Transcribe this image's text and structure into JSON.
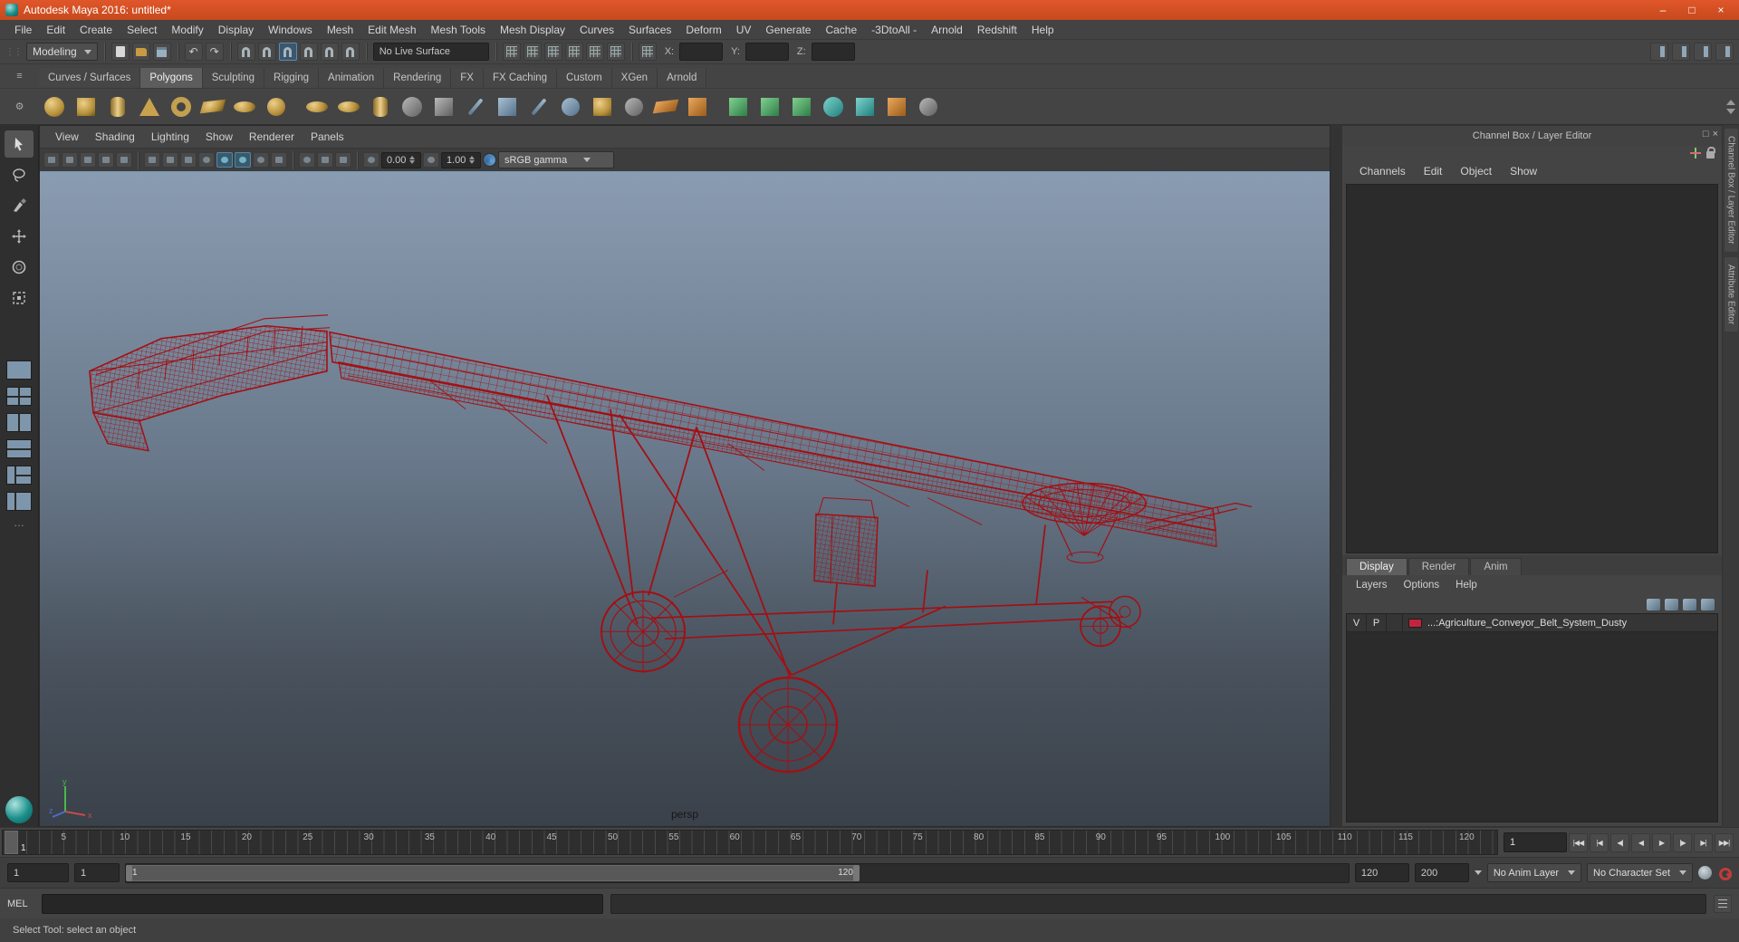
{
  "window": {
    "title": "Autodesk Maya 2016: untitled*",
    "minimize": "–",
    "maximize": "□",
    "close": "×"
  },
  "menubar": [
    "File",
    "Edit",
    "Create",
    "Select",
    "Modify",
    "Display",
    "Windows",
    "Mesh",
    "Edit Mesh",
    "Mesh Tools",
    "Mesh Display",
    "Curves",
    "Surfaces",
    "Deform",
    "UV",
    "Generate",
    "Cache",
    "-3DtoAll -",
    "Arnold",
    "Redshift",
    "Help"
  ],
  "status_line": {
    "mode": "Modeling",
    "live_surface": "No Live Surface",
    "x_label": "X:",
    "y_label": "Y:",
    "z_label": "Z:"
  },
  "icons": {
    "undo": "↶",
    "redo": "↷",
    "dock": "□",
    "close_small": "×",
    "hamburger": "≡",
    "gear": "⚙"
  },
  "shelf_tabs": [
    "Curves / Surfaces",
    "Polygons",
    "Sculpting",
    "Rigging",
    "Animation",
    "Rendering",
    "FX",
    "FX Caching",
    "Custom",
    "XGen",
    "Arnold"
  ],
  "viewport": {
    "menus": [
      "View",
      "Shading",
      "Lighting",
      "Show",
      "Renderer",
      "Panels"
    ],
    "exposure": "0.00",
    "gamma": "1.00",
    "colorspace": "sRGB gamma",
    "camera_label": "persp",
    "axis": {
      "x": "x",
      "y": "y",
      "z": "z"
    }
  },
  "channel_box": {
    "header": "Channel Box / Layer Editor",
    "menus": [
      "Channels",
      "Edit",
      "Object",
      "Show"
    ]
  },
  "layer_editor": {
    "tabs": [
      "Display",
      "Render",
      "Anim"
    ],
    "menus": [
      "Layers",
      "Options",
      "Help"
    ],
    "layer": {
      "v": "V",
      "p": "P",
      "name": "...:Agriculture_Conveyor_Belt_System_Dusty"
    }
  },
  "side_tabs": [
    "Channel Box / Layer Editor",
    "Attribute Editor"
  ],
  "timeline": {
    "ticks": [
      "5",
      "10",
      "15",
      "20",
      "25",
      "30",
      "35",
      "40",
      "45",
      "50",
      "55",
      "60",
      "65",
      "70",
      "75",
      "80",
      "85",
      "90",
      "95",
      "100",
      "105",
      "110",
      "115",
      "120"
    ],
    "current": "1",
    "frame_field": "1",
    "playback": [
      "|◀◀",
      "|◀",
      "◀|",
      "◀",
      "▶",
      "|▶",
      "▶|",
      "▶▶|"
    ]
  },
  "range_slider": {
    "anim_start": "1",
    "play_start": "1",
    "inner_start": "1",
    "inner_end": "120",
    "play_end": "120",
    "anim_end": "200",
    "anim_layer": "No Anim Layer",
    "char_set": "No Character Set"
  },
  "command_line": {
    "label": "MEL"
  },
  "help_line": {
    "text": "Select Tool: select an object"
  }
}
